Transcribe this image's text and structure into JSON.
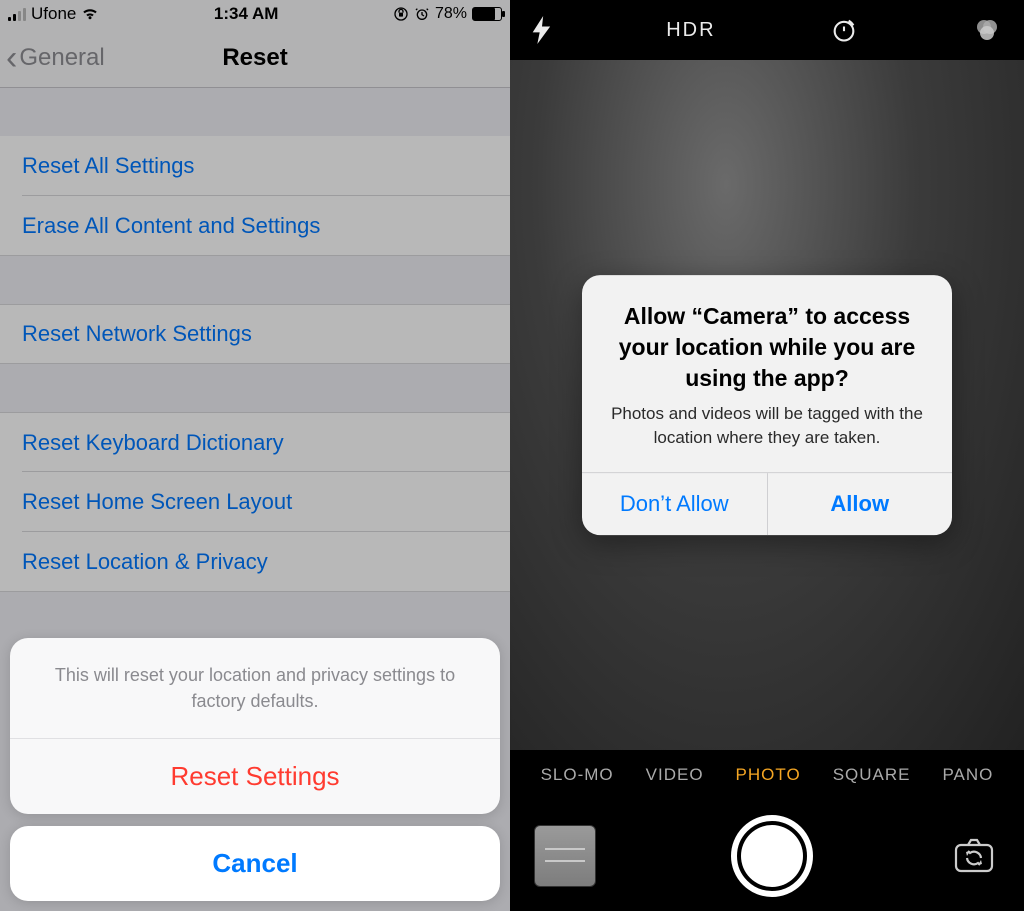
{
  "left": {
    "status": {
      "carrier": "Ufone",
      "time": "1:34 AM",
      "battery_pct": "78%"
    },
    "nav": {
      "back_label": "General",
      "title": "Reset"
    },
    "rows": {
      "reset_all": "Reset All Settings",
      "erase_all": "Erase All Content and Settings",
      "reset_network": "Reset Network Settings",
      "reset_keyboard": "Reset Keyboard Dictionary",
      "reset_home": "Reset Home Screen Layout",
      "reset_location": "Reset Location & Privacy"
    },
    "sheet": {
      "message": "This will reset your location and privacy settings to factory defaults.",
      "destructive": "Reset Settings",
      "cancel": "Cancel"
    }
  },
  "right": {
    "top": {
      "hdr": "HDR"
    },
    "alert": {
      "title": "Allow “Camera” to access your location while you are using the app?",
      "subtitle": "Photos and videos will be tagged with the location where they are taken.",
      "deny": "Don’t Allow",
      "allow": "Allow"
    },
    "modes": {
      "slomo": "SLO-MO",
      "video": "VIDEO",
      "photo": "PHOTO",
      "square": "SQUARE",
      "pano": "PANO"
    }
  }
}
